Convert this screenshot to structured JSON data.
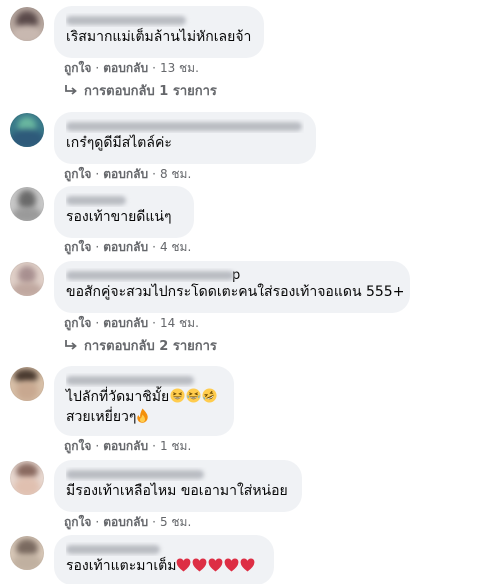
{
  "comments": [
    {
      "author": "",
      "author_tail": "",
      "lines": [
        "เริสมากแม่เต็มล้านไม่หักเลยจ้า"
      ],
      "like": "ถูกใจ",
      "reply": "ตอบกลับ",
      "time": "13 ชม.",
      "replies": "การตอบกลับ 1 รายการ",
      "avatar_colors": [
        "#5a4a4a",
        "#b8a8a0"
      ]
    },
    {
      "author": "",
      "author_tail": "",
      "lines": [
        "เกร๋ๆดูดีมีสไตล์ค่ะ"
      ],
      "like": "ถูกใจ",
      "reply": "ตอบกลับ",
      "time": "8 ชม.",
      "replies": "",
      "avatar_colors": [
        "#5aa89a",
        "#2e6a8a"
      ]
    },
    {
      "author": "",
      "author_tail": "",
      "lines": [
        "รองเท้าขายดีแน่ๆ"
      ],
      "like": "ถูกใจ",
      "reply": "ตอบกลับ",
      "time": "4 ชม.",
      "replies": "",
      "avatar_colors": [
        "#6a6a6a",
        "#c8c8c8"
      ]
    },
    {
      "author": "",
      "author_tail": "p",
      "lines": [
        "ขอสักคู่จะสวมไปกระโดดเตะคนใส่รองเท้าจอแดน 555+"
      ],
      "like": "ถูกใจ",
      "reply": "ตอบกลับ",
      "time": "14 ชม.",
      "replies": "การตอบกลับ 2 รายการ",
      "avatar_colors": [
        "#a89090",
        "#e0d0c8"
      ]
    },
    {
      "author": "",
      "author_tail": "",
      "lines": [
        "ไปลักที่วัดมาชิมั้ย",
        "สวยเหยี่ยวๆ"
      ],
      "like": "ถูกใจ",
      "reply": "ตอบกลับ",
      "time": "1 ชม.",
      "replies": "",
      "avatar_colors": [
        "#4a3a30",
        "#d8c0a8"
      ]
    },
    {
      "author": "",
      "author_tail": "",
      "lines": [
        "มีรองเท้าเหลือไหม ขอเอามาใส่หน่อย"
      ],
      "like": "ถูกใจ",
      "reply": "ตอบกลับ",
      "time": "5 ชม.",
      "replies": "",
      "avatar_colors": [
        "#8a6a60",
        "#e8d8d0"
      ]
    },
    {
      "author": "",
      "author_tail": "",
      "lines": [
        "รองเท้าแตะมาเต็ม"
      ],
      "like": "",
      "reply": "",
      "time": "",
      "replies": "",
      "avatar_colors": [
        "#7a6a60",
        "#d8c8b8"
      ]
    }
  ],
  "icons": {
    "reply_arrow": "reply-arrow-icon",
    "laugh": "grinning-squinting-face-emoji",
    "rofl": "rolling-on-floor-laughing-emoji",
    "fire": "fire-emoji",
    "heart": "red-heart-emoji"
  },
  "colors": {
    "bubble": "#f0f2f5",
    "meta": "#65676b",
    "text": "#050505",
    "heart": "#e0245e"
  }
}
